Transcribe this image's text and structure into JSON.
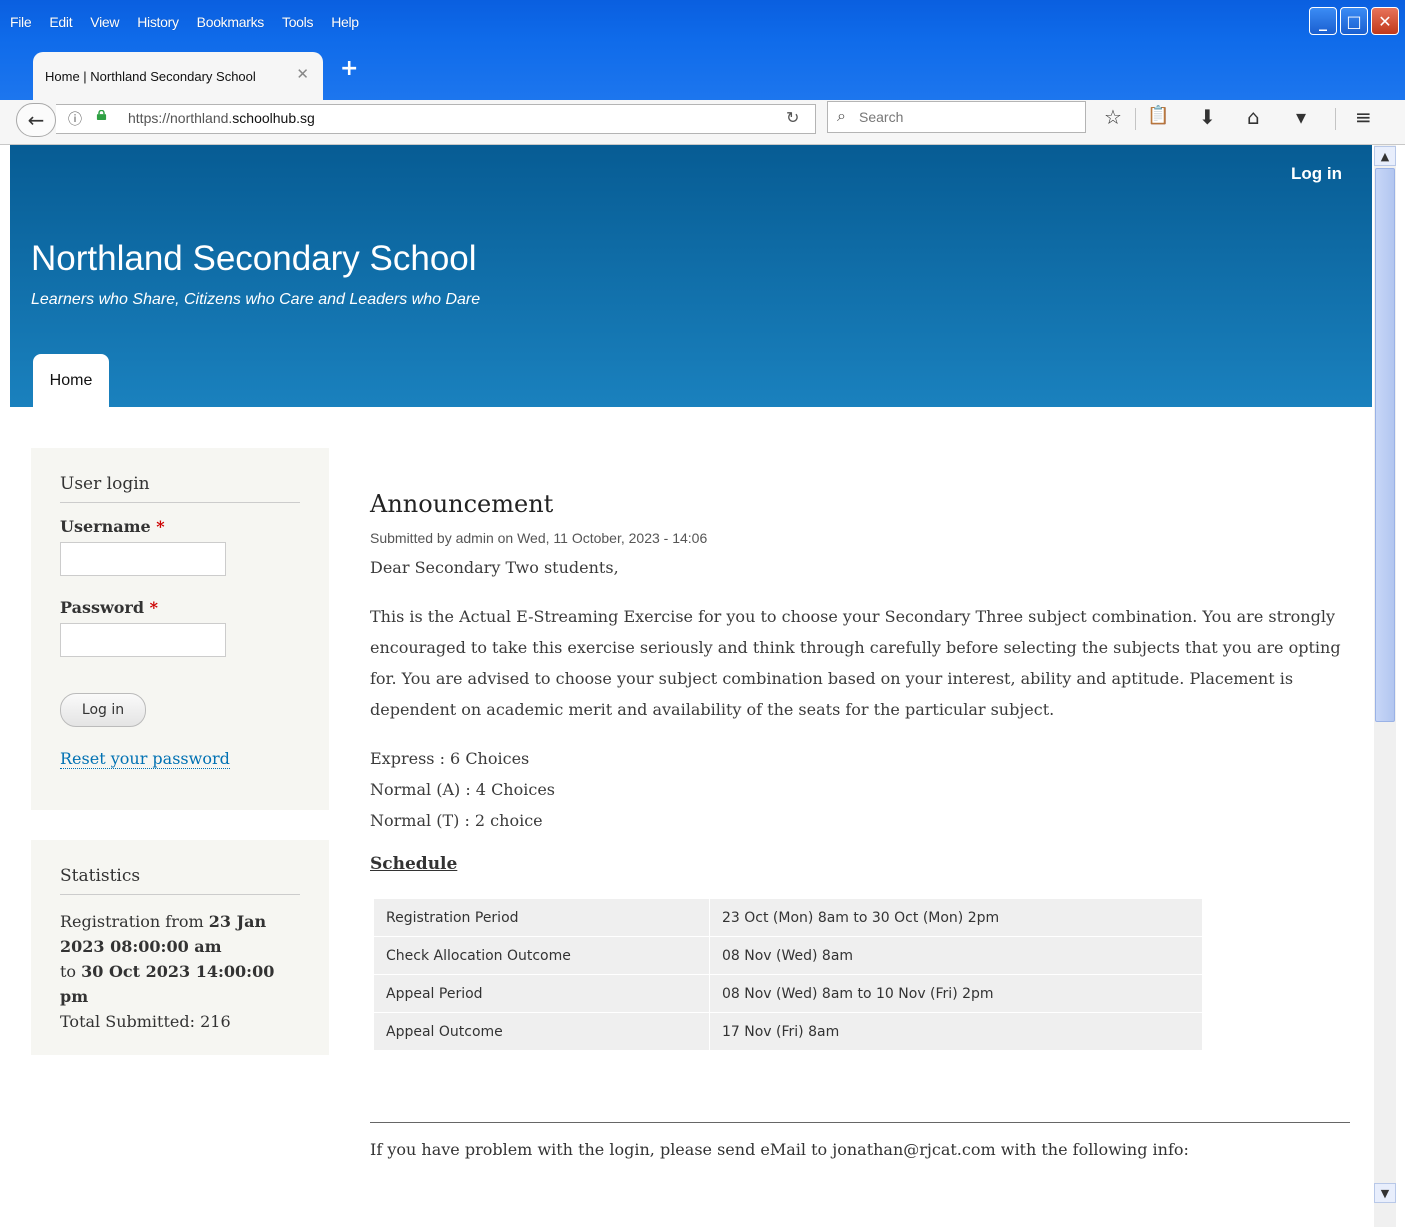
{
  "menu": [
    "File",
    "Edit",
    "View",
    "History",
    "Bookmarks",
    "Tools",
    "Help"
  ],
  "window": {
    "minimize": "_",
    "maximize": "□",
    "close": "✕"
  },
  "tab": {
    "title": "Home | Northland Secondary School",
    "close": "✕",
    "new": "+"
  },
  "url": {
    "prefix": "https://northland.",
    "domain": "schoolhub.sg"
  },
  "search": {
    "placeholder": "Search"
  },
  "site": {
    "login_link": "Log in",
    "name": "Northland Secondary School",
    "slogan": "Learners who Share, Citizens who Care and Leaders who Dare",
    "nav_home": "Home"
  },
  "login_block": {
    "title": "User login",
    "username_label": "Username",
    "password_label": "Password",
    "required": "*",
    "button": "Log in",
    "reset": "Reset your password"
  },
  "stats_block": {
    "title": "Statistics",
    "reg_from_label": "Registration from",
    "reg_from": "23 Jan 2023 08:00:00 am",
    "to_label": "to",
    "reg_to": "30 Oct 2023 14:00:00 pm",
    "total_label": "Total Submitted:",
    "total": "216"
  },
  "article": {
    "title": "Announcement",
    "submitted": "Submitted by admin on Wed, 11 October, 2023 - 14:06",
    "greeting": "Dear Secondary Two students,",
    "body": "This is the Actual E-Streaming Exercise for you to choose your Secondary Three subject combination. You are strongly encouraged to take this exercise seriously and think through carefully before selecting the subjects that you are opting for. You are advised to choose your subject combination based on your interest, ability and aptitude. Placement is dependent on academic merit and availability of the seats for the particular subject.",
    "choices": [
      "Express : 6 Choices",
      "Normal (A) : 4 Choices",
      "Normal (T) : 2 choice"
    ],
    "schedule_heading": "Schedule",
    "schedule": [
      [
        "Registration Period",
        "23 Oct (Mon) 8am to 30 Oct (Mon) 2pm"
      ],
      [
        "Check Allocation Outcome",
        "08 Nov (Wed) 8am"
      ],
      [
        "Appeal Period",
        "08 Nov (Wed) 8am to 10 Nov (Fri) 2pm"
      ],
      [
        "Appeal Outcome",
        "17 Nov (Fri) 8am"
      ]
    ],
    "footer": "If you have problem with the login, please send eMail to jonathan@rjcat.com with the following info:"
  }
}
